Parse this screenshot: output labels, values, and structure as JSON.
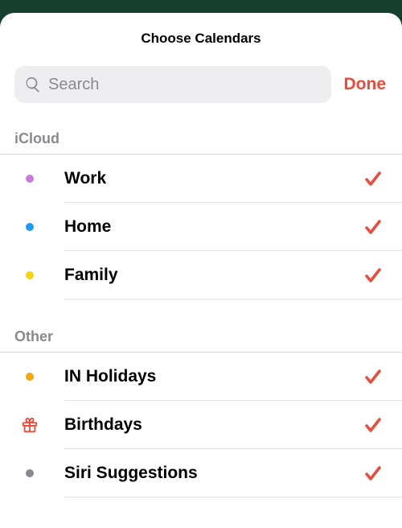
{
  "header": {
    "title": "Choose Calendars"
  },
  "search": {
    "placeholder": "Search"
  },
  "done": {
    "label": "Done"
  },
  "colors": {
    "accent": "#ee4a3a"
  },
  "sections": {
    "icloud": {
      "title": "iCloud",
      "items": [
        {
          "label": "Work",
          "dot": "#c97ae0",
          "checked": true
        },
        {
          "label": "Home",
          "dot": "#1f9af0",
          "checked": true
        },
        {
          "label": "Family",
          "dot": "#f7d40c",
          "checked": true
        }
      ]
    },
    "other": {
      "title": "Other",
      "items": [
        {
          "label": "IN Holidays",
          "dot": "#f6a50b",
          "checked": true,
          "icon": "dot"
        },
        {
          "label": "Birthdays",
          "dot": "#ee4a3a",
          "checked": true,
          "icon": "gift"
        },
        {
          "label": "Siri Suggestions",
          "dot": "#8a8a8e",
          "checked": true,
          "icon": "dot"
        }
      ]
    }
  }
}
